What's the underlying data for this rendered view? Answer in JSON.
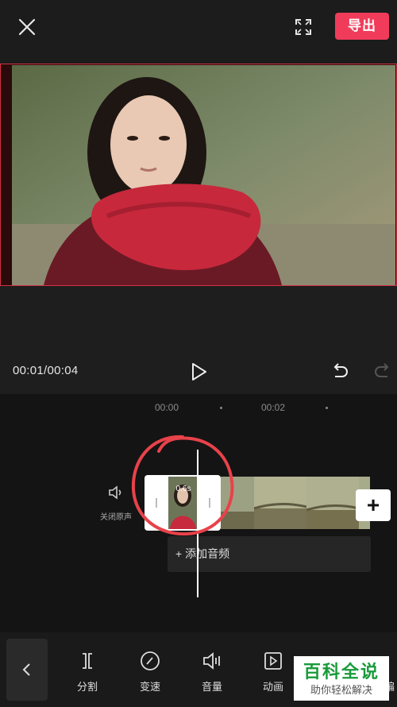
{
  "header": {
    "close_icon": "close-icon",
    "fullscreen_icon": "fullscreen-icon",
    "export_label": "导出"
  },
  "player": {
    "time_readout": "00:01/00:04",
    "play_icon": "play-icon",
    "undo_icon": "undo-icon",
    "redo_icon": "redo-icon"
  },
  "timeline": {
    "ruler": [
      "00:00",
      "00:02"
    ],
    "mute_label": "关闭原声",
    "clip_duration": "0.6s",
    "add_audio_label": "添加音频",
    "add_clip_icon": "plus-icon"
  },
  "toolbar": {
    "items": [
      {
        "label": "分割",
        "icon": "split-icon"
      },
      {
        "label": "变速",
        "icon": "speed-icon"
      },
      {
        "label": "音量",
        "icon": "volume-icon"
      },
      {
        "label": "动画",
        "icon": "animation-icon"
      }
    ],
    "partial_label": "编"
  },
  "watermark": {
    "title": "百科全说",
    "subtitle": "助你轻松解决"
  },
  "colors": {
    "accent": "#f03c5a",
    "annotation": "#e8424a",
    "background": "#1e1e1e"
  }
}
